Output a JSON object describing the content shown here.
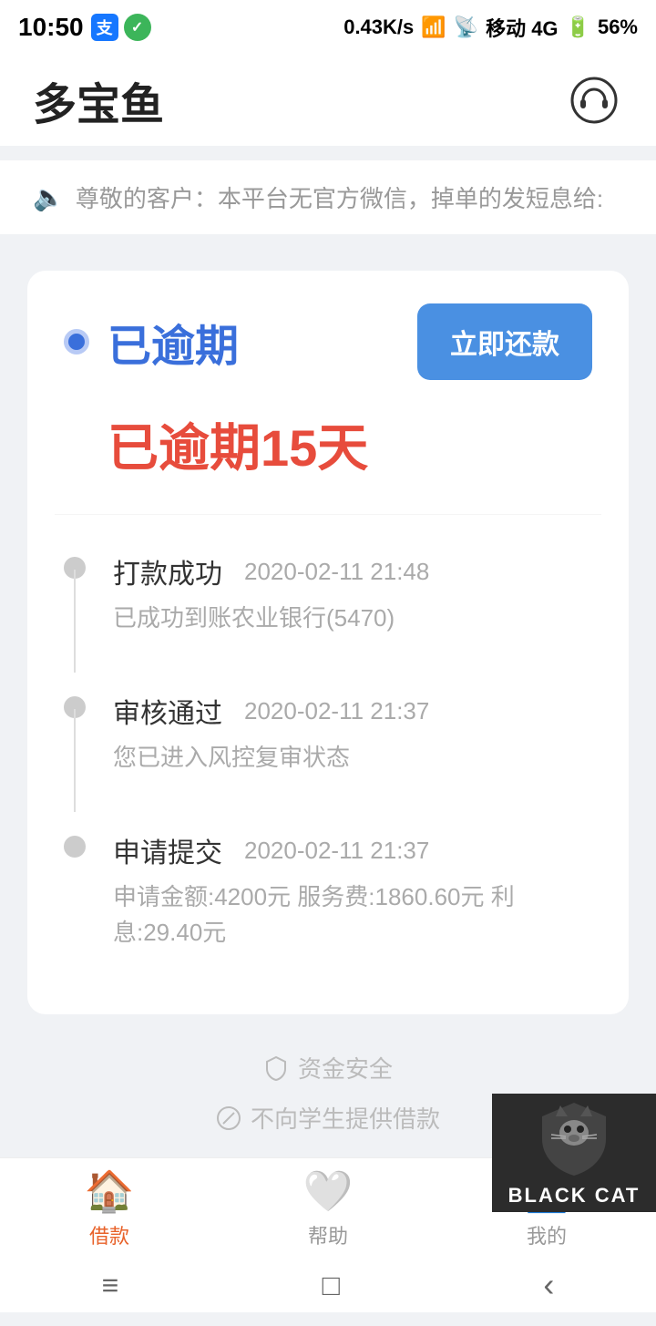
{
  "statusBar": {
    "time": "10:50",
    "network": "0.43K/s",
    "battery": "56%",
    "carrier": "移动 4G"
  },
  "header": {
    "title": "多宝鱼",
    "supportIcon": "headphone-icon"
  },
  "notice": {
    "text": "尊敬的客户：本平台无官方微信，掉单的发短息给:"
  },
  "overdueCard": {
    "status": "已逾期",
    "repayBtn": "立即还款",
    "daysPrefix": "已逾期",
    "days": "15",
    "daysSuffix": "天"
  },
  "timeline": [
    {
      "title": "打款成功",
      "time": "2020-02-11 21:48",
      "desc": "已成功到账农业银行(5470)"
    },
    {
      "title": "审核通过",
      "time": "2020-02-11 21:37",
      "desc": "您已进入风控复审状态"
    },
    {
      "title": "申请提交",
      "time": "2020-02-11 21:37",
      "desc": "申请金额:4200元  服务费:1860.60元 利息:29.40元"
    }
  ],
  "footer": {
    "security1": "资金安全",
    "security2": "不向学生提供借款"
  },
  "bottomNav": [
    {
      "label": "借款",
      "active": true
    },
    {
      "label": "帮助",
      "active": false
    },
    {
      "label": "我的",
      "active": false
    }
  ],
  "blackCat": {
    "text": "BLACK CAT"
  },
  "systemBar": {
    "menu": "≡",
    "home": "□",
    "back": "‹"
  }
}
